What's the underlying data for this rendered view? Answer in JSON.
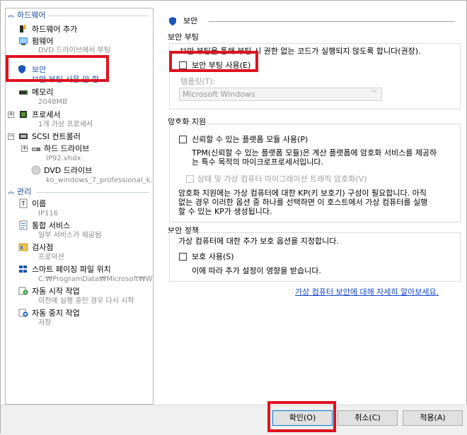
{
  "left_panel": {
    "hardware_header": "하드웨어",
    "management_header": "관리",
    "items": {
      "add_hardware": {
        "label": "하드웨어 추가"
      },
      "firmware": {
        "label": "펌웨어",
        "sub": "DVD 드라이브에서 부팅"
      },
      "security": {
        "label": "보안",
        "sub": "보안 부팅 사용 안 함"
      },
      "memory": {
        "label": "메모리",
        "sub": "2048MB"
      },
      "processor": {
        "label": "프로세서",
        "sub": "1개 가상 프로세서"
      },
      "scsi": {
        "label": "SCSI 컨트롤러"
      },
      "hard_drive": {
        "label": "하드 드라이브",
        "sub": "IP92.vhdx"
      },
      "dvd_drive": {
        "label": "DVD 드라이브",
        "sub": "ko_windows_7_professional_k..."
      },
      "name": {
        "label": "이름",
        "sub": "IP116"
      },
      "integration": {
        "label": "통합 서비스",
        "sub": "일부 서비스가 제공됨"
      },
      "checkpoint": {
        "label": "검사점",
        "sub": "프로덕션"
      },
      "smart_paging": {
        "label": "스마트 페이징 파일 위치",
        "sub": "C:₩ProgramData₩Microsoft₩Wi..."
      },
      "auto_start": {
        "label": "자동 시작 작업",
        "sub": "이전에 실행 중인 경우 다시 시작"
      },
      "auto_stop": {
        "label": "자동 중지 작업",
        "sub": "저장"
      }
    }
  },
  "right_panel": {
    "title": "보안",
    "secure_boot": {
      "group_title": "보안 부팅",
      "description": "보안 부팅을 통해 부팅 시 권한 없는 코드가 실행되지 않도록 합니다(권장).",
      "checkbox_label": "보안 부팅 사용(E)",
      "template_label": "템플릿(T):",
      "template_value": "Microsoft Windows"
    },
    "encryption": {
      "group_title": "암호화 지원",
      "tpm_checkbox": "신뢰할 수 있는 플랫폼 모듈 사용(P)",
      "tpm_desc_1": "TPM(신뢰할 수 있는 플랫폼 모듈)은 계산 플랫폼에 암호화 서비스를 제공하",
      "tpm_desc_2": "는 특수 목적의 마이크로프로세서입니다.",
      "state_checkbox": "상태 및 가상 컴퓨터 마이그레이션 트래픽 암호화(V)",
      "kp_desc_1": "암호화 지원에는 가상 컴퓨터에 대한 KP(키 보호기) 구성이 필요합니다. 아직",
      "kp_desc_2": "없는 경우 이러한 옵션 중 하나를 선택하면 이 호스트에서 가상 컴퓨터를 실행",
      "kp_desc_3": "할 수 있는 KP가 생성됩니다."
    },
    "policy": {
      "group_title": "보안 정책",
      "desc": "가상 컴퓨터에 대한 추가 보호 옵션을 지정합니다.",
      "shield_checkbox": "보호 사용(S)",
      "shield_desc": "이에 따라 추가 설정이 영향을 받습니다."
    },
    "link": "가상 컴퓨터 보안에 대해 자세히 알아보세요."
  },
  "footer": {
    "ok": "확인(O)",
    "cancel": "취소(C)",
    "apply": "적용(A)"
  },
  "colors": {
    "accent": "#1a55b8",
    "highlight_box": "#e0121f",
    "link": "#1546c9"
  }
}
